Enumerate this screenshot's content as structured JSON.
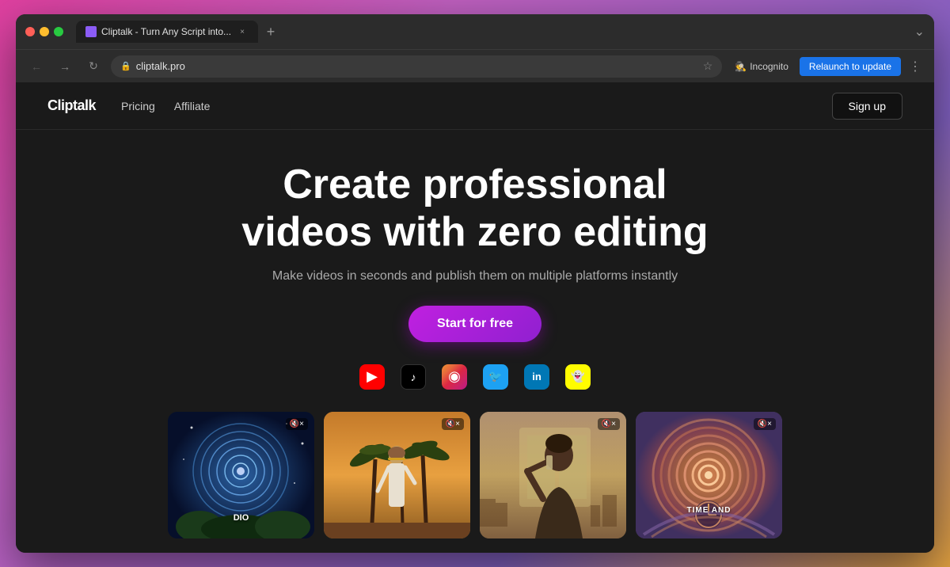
{
  "browser": {
    "tab_title": "Cliptalk - Turn Any Script into...",
    "tab_close": "×",
    "tab_new": "+",
    "nav_back": "←",
    "nav_forward": "→",
    "nav_close": "×",
    "url": "cliptalk.pro",
    "star_icon": "☆",
    "incognito_label": "Incognito",
    "relaunch_label": "Relaunch to update",
    "three_dots": "⋮",
    "chrome_end": "⌄"
  },
  "site": {
    "logo": "Cliptalk",
    "nav_links": [
      {
        "label": "Pricing",
        "id": "pricing"
      },
      {
        "label": "Affiliate",
        "id": "affiliate"
      }
    ],
    "signup_label": "Sign up"
  },
  "hero": {
    "title_line1": "Create professional",
    "title_line2": "videos with zero editing",
    "subtitle": "Make videos in seconds and publish them on multiple platforms instantly",
    "cta_label": "Start for free",
    "platforms": [
      {
        "id": "youtube",
        "label": "YouTube",
        "symbol": "▶"
      },
      {
        "id": "tiktok",
        "label": "TikTok",
        "symbol": "♪"
      },
      {
        "id": "instagram",
        "label": "Instagram",
        "symbol": "◎"
      },
      {
        "id": "twitter",
        "label": "Twitter",
        "symbol": "🐦"
      },
      {
        "id": "linkedin",
        "label": "LinkedIn",
        "symbol": "in"
      },
      {
        "id": "snapchat",
        "label": "Snapchat",
        "symbol": "👻"
      }
    ]
  },
  "videos": [
    {
      "id": "starry",
      "label": "DIO",
      "mute": "🔇×"
    },
    {
      "id": "desert",
      "label": "",
      "mute": "🔇×"
    },
    {
      "id": "drinking",
      "label": "",
      "mute": "🔇×"
    },
    {
      "id": "vortex",
      "label": "TIME AND",
      "mute": "🔇×"
    }
  ],
  "colors": {
    "accent_purple": "#c020e0",
    "relaunch_blue": "#1a73e8",
    "bg_dark": "#1a1a1a"
  }
}
